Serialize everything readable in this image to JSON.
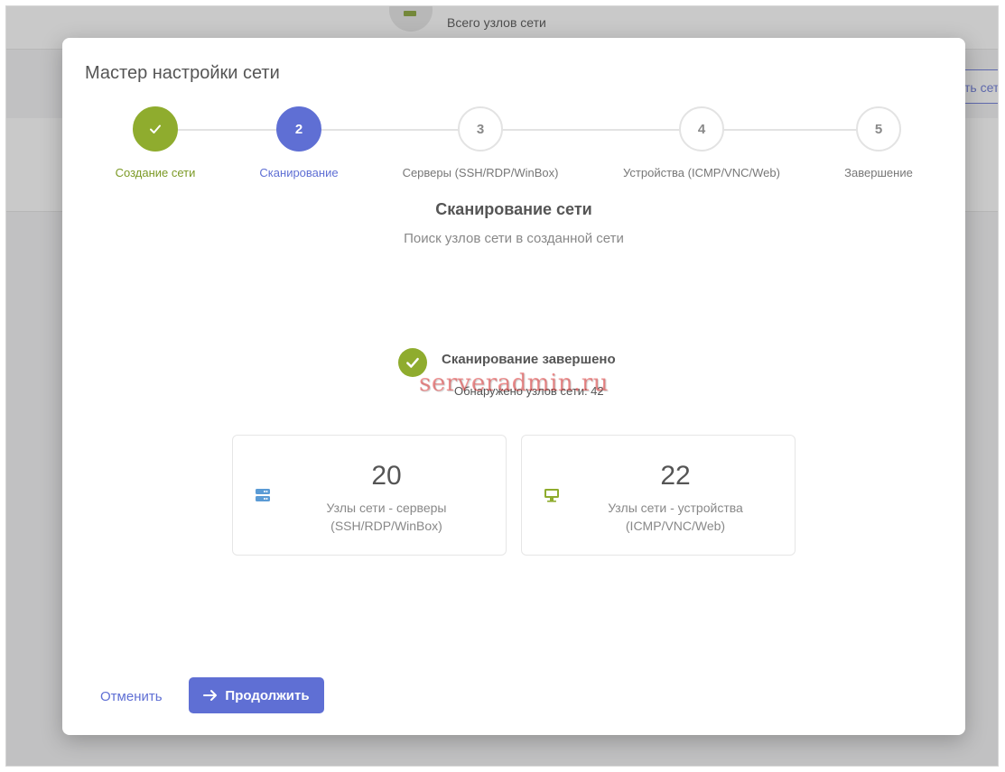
{
  "background": {
    "header_label": "Всего узлов сети",
    "link_partial": "ть сет"
  },
  "modal": {
    "title": "Мастер настройки сети"
  },
  "stepper": {
    "steps": [
      {
        "number": "",
        "label": "Создание сети",
        "state": "done"
      },
      {
        "number": "2",
        "label": "Сканирование",
        "state": "active"
      },
      {
        "number": "3",
        "label": "Серверы (SSH/RDP/WinBox)",
        "state": "pending"
      },
      {
        "number": "4",
        "label": "Устройства (ICMP/VNC/Web)",
        "state": "pending"
      },
      {
        "number": "5",
        "label": "Завершение",
        "state": "pending"
      }
    ]
  },
  "section": {
    "title": "Сканирование сети",
    "subtitle": "Поиск узлов сети в созданной сети"
  },
  "scan": {
    "status": "Сканирование завершено",
    "found": "Обнаружено узлов сети: 42",
    "watermark": "serveradmin.ru"
  },
  "cards": [
    {
      "value": "20",
      "line1": "Узлы сети - серверы",
      "line2": "(SSH/RDP/WinBox)",
      "icon": "server-icon",
      "color": "#5b9bd5"
    },
    {
      "value": "22",
      "line1": "Узлы сети - устройства",
      "line2": "(ICMP/VNC/Web)",
      "icon": "monitor-icon",
      "color": "#8fac2e"
    }
  ],
  "actions": {
    "cancel": "Отменить",
    "continue": "Продолжить"
  },
  "colors": {
    "primary": "#5f6fd4",
    "success": "#8fac2e"
  }
}
